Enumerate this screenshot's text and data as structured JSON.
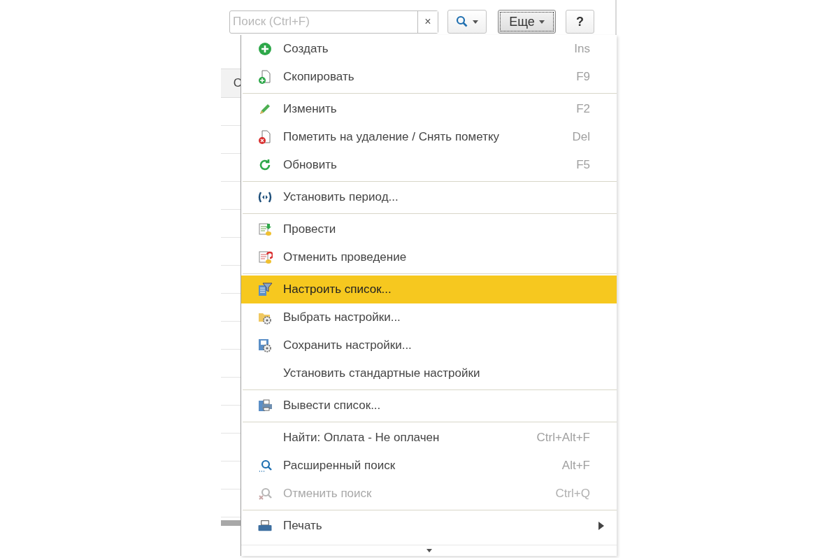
{
  "toolbar": {
    "search": {
      "placeholder": "Поиск (Ctrl+F)",
      "clear": "×"
    },
    "more_button": {
      "label": "Еще",
      "focused": true
    },
    "help_button": {
      "label": "?"
    }
  },
  "table": {
    "header": "С"
  },
  "menu": {
    "items": [
      {
        "kind": "item",
        "label": "Создать",
        "shortcut": "Ins",
        "selected": false,
        "disabled": false
      },
      {
        "kind": "item",
        "label": "Скопировать",
        "shortcut": "F9",
        "selected": false,
        "disabled": false
      },
      {
        "kind": "separator"
      },
      {
        "kind": "item",
        "label": "Изменить",
        "shortcut": "F2",
        "selected": false,
        "disabled": false
      },
      {
        "kind": "item",
        "label": "Пометить на удаление / Снять пометку",
        "shortcut": "Del",
        "selected": false,
        "disabled": false
      },
      {
        "kind": "item",
        "label": "Обновить",
        "shortcut": "F5",
        "selected": false,
        "disabled": false
      },
      {
        "kind": "separator"
      },
      {
        "kind": "item",
        "label": "Установить период...",
        "selected": false,
        "disabled": false
      },
      {
        "kind": "separator"
      },
      {
        "kind": "item",
        "label": "Провести",
        "selected": false,
        "disabled": false
      },
      {
        "kind": "item",
        "label": "Отменить проведение",
        "selected": false,
        "disabled": false
      },
      {
        "kind": "separator"
      },
      {
        "kind": "item",
        "label": "Настроить список...",
        "selected": true,
        "disabled": false
      },
      {
        "kind": "item",
        "label": "Выбрать настройки...",
        "selected": false,
        "disabled": false
      },
      {
        "kind": "item",
        "label": "Сохранить настройки...",
        "selected": false,
        "disabled": false
      },
      {
        "kind": "item",
        "label": "Установить стандартные настройки",
        "selected": false,
        "disabled": false
      },
      {
        "kind": "separator"
      },
      {
        "kind": "item",
        "label": "Вывести список...",
        "selected": false,
        "disabled": false
      },
      {
        "kind": "separator"
      },
      {
        "kind": "item",
        "label": "Найти: Оплата - Не оплачен",
        "shortcut": "Ctrl+Alt+F",
        "selected": false,
        "disabled": false
      },
      {
        "kind": "item",
        "label": "Расширенный поиск",
        "shortcut": "Alt+F",
        "selected": false,
        "disabled": false
      },
      {
        "kind": "item",
        "label": "Отменить поиск",
        "shortcut": "Ctrl+Q",
        "selected": false,
        "disabled": true
      },
      {
        "kind": "separator"
      },
      {
        "kind": "item",
        "label": "Печать",
        "submenu": true,
        "selected": false,
        "disabled": false
      }
    ]
  }
}
